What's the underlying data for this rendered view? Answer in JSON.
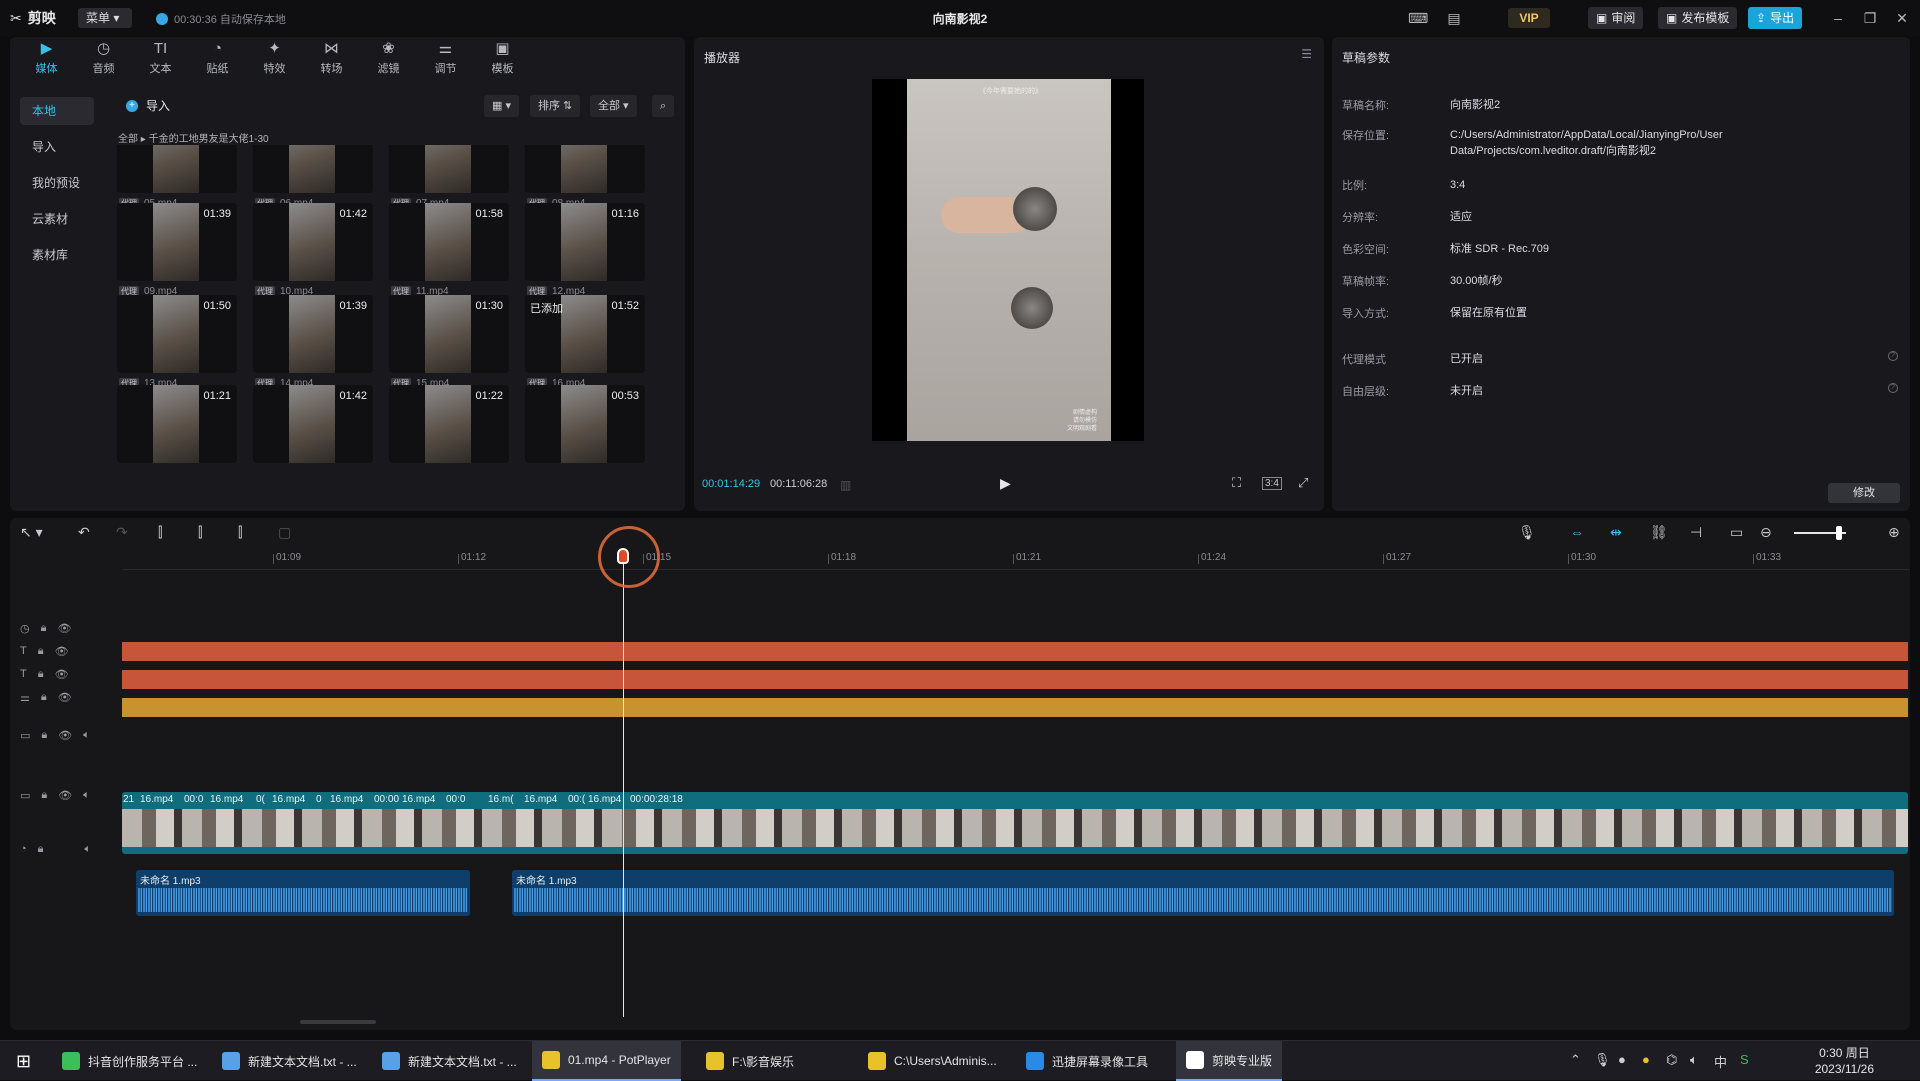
{
  "app": {
    "logo": "剪映",
    "menu_label": "菜单",
    "autosave": "00:30:36 自动保存本地",
    "project_title": "向南影视2",
    "review_label": "审阅",
    "publish_template_label": "发布模板",
    "export_label": "导出",
    "vip_label": "VIP"
  },
  "media_tabs": [
    {
      "label": "媒体",
      "icon": "media-icon"
    },
    {
      "label": "音频",
      "icon": "audio-icon"
    },
    {
      "label": "文本",
      "icon": "text-icon"
    },
    {
      "label": "贴纸",
      "icon": "sticker-icon"
    },
    {
      "label": "特效",
      "icon": "effects-icon"
    },
    {
      "label": "转场",
      "icon": "transition-icon"
    },
    {
      "label": "滤镜",
      "icon": "filter-icon"
    },
    {
      "label": "调节",
      "icon": "adjust-icon"
    },
    {
      "label": "模板",
      "icon": "template-icon"
    }
  ],
  "sidebar": {
    "items": [
      {
        "label": "本地"
      },
      {
        "label": "导入"
      },
      {
        "label": "我的预设"
      },
      {
        "label": "云素材"
      },
      {
        "label": "素材库"
      }
    ]
  },
  "media": {
    "import_label": "导入",
    "sort_label": "排序",
    "filter_label": "全部",
    "breadcrumb_root": "全部",
    "breadcrumb_folder": "千金的工地男友是大佬1-30",
    "proxy_tag": "代理",
    "rows": [
      [
        {
          "name": "05.mp4",
          "dur": ""
        },
        {
          "name": "06.mp4",
          "dur": ""
        },
        {
          "name": "07.mp4",
          "dur": ""
        },
        {
          "name": "08.mp4",
          "dur": ""
        }
      ],
      [
        {
          "name": "09.mp4",
          "dur": "01:39"
        },
        {
          "name": "10.mp4",
          "dur": "01:42"
        },
        {
          "name": "11.mp4",
          "dur": "01:58"
        },
        {
          "name": "12.mp4",
          "dur": "01:16"
        }
      ],
      [
        {
          "name": "13.mp4",
          "dur": "01:50"
        },
        {
          "name": "14.mp4",
          "dur": "01:39"
        },
        {
          "name": "15.mp4",
          "dur": "01:30"
        },
        {
          "name": "16.mp4",
          "dur": "01:52",
          "badge": "已添加"
        }
      ],
      [
        {
          "name": "",
          "dur": "01:21"
        },
        {
          "name": "",
          "dur": "01:42"
        },
        {
          "name": "",
          "dur": "01:22"
        },
        {
          "name": "",
          "dur": "00:53"
        }
      ]
    ]
  },
  "player": {
    "title": "播放器",
    "current_time": "00:01:14:29",
    "total_time": "00:11:06:28",
    "ratio_label": "3:4",
    "overlay_top": "《今年需要她的的》",
    "overlay_corner": "剧情虚构\n请勿模仿\n文明观剧看"
  },
  "props": {
    "title": "草稿参数",
    "rows": [
      {
        "k": "草稿名称:",
        "v": "向南影视2"
      },
      {
        "k": "保存位置:",
        "v": "C:/Users/Administrator/AppData/Local/JianyingPro/User Data/Projects/com.lveditor.draft/向南影视2"
      },
      {
        "k": "比例:",
        "v": "3:4"
      },
      {
        "k": "分辨率:",
        "v": "适应"
      },
      {
        "k": "色彩空间:",
        "v": "标准 SDR - Rec.709"
      },
      {
        "k": "草稿帧率:",
        "v": "30.00帧/秒"
      },
      {
        "k": "导入方式:",
        "v": "保留在原有位置"
      },
      {
        "k": "代理模式",
        "v": "已开启"
      },
      {
        "k": "自由层级:",
        "v": "未开启"
      }
    ],
    "edit_label": "修改"
  },
  "timeline": {
    "ticks": [
      "01:09",
      "01:12",
      "01:15",
      "01:18",
      "01:21",
      "01:24",
      "01:27",
      "01:30",
      "01:33"
    ],
    "video_labels": [
      "21",
      "16.mp4",
      "00:0",
      "16.mp4",
      "0(",
      "16.mp4",
      "0",
      "16.mp4",
      "00:00",
      "16.mp4",
      "00:0",
      "16.m(",
      "16.mp4",
      "00:(",
      "16.mp4",
      "00:00:28:18"
    ],
    "audio_clip_label": "未命名 1.mp3",
    "colors": {
      "text_track": "#c6553a",
      "adjust_track": "#c8922e",
      "video_track": "#0f6d7e",
      "audio_track": "#0f3e6b"
    }
  },
  "taskbar": {
    "items": [
      {
        "label": "抖音创作服务平台 ..."
      },
      {
        "label": "新建文本文档.txt - ..."
      },
      {
        "label": "新建文本文档.txt - ..."
      },
      {
        "label": "01.mp4 - PotPlayer"
      },
      {
        "label": "F:\\影音娱乐"
      },
      {
        "label": "C:\\Users\\Adminis..."
      },
      {
        "label": "迅捷屏幕录像工具"
      },
      {
        "label": "剪映专业版"
      }
    ],
    "clock_time": "0:30 周日",
    "clock_date": "2023/11/26",
    "ime_label": "中"
  }
}
